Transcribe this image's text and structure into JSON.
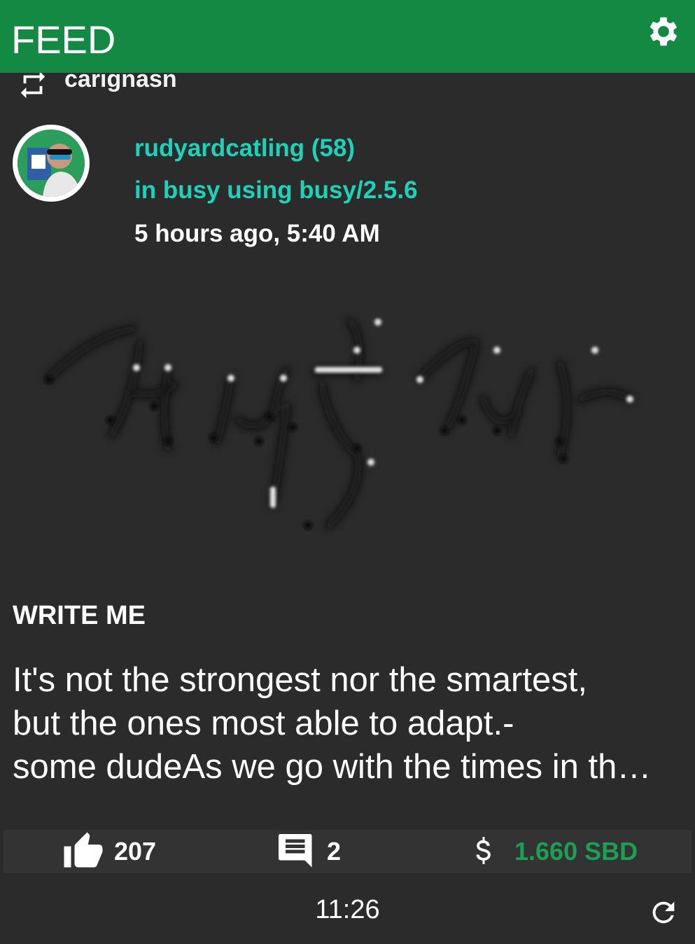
{
  "header": {
    "title": "FEED",
    "settings_icon": "gear-icon"
  },
  "reblog": {
    "icon": "reblog-icon",
    "user": "carignasn"
  },
  "post": {
    "author": "rudyardcatling (58)",
    "app": "in busy using busy/2.5.6",
    "time": "5 hours ago, 5:40 AM",
    "title": "WRITE ME",
    "body_lines": [
      "It's not the strongest nor the smartest,",
      "but the ones most able to adapt.-",
      "some dudeAs we go with the times in th…"
    ]
  },
  "actions": {
    "likes": "207",
    "comments": "2",
    "payout": "1.660 SBD"
  },
  "footer": {
    "time": "11:26",
    "refresh_icon": "refresh-icon"
  },
  "colors": {
    "header": "#148944",
    "accent": "#1fd1b8",
    "payout": "#1e9e55",
    "background": "#2b2b2b"
  }
}
